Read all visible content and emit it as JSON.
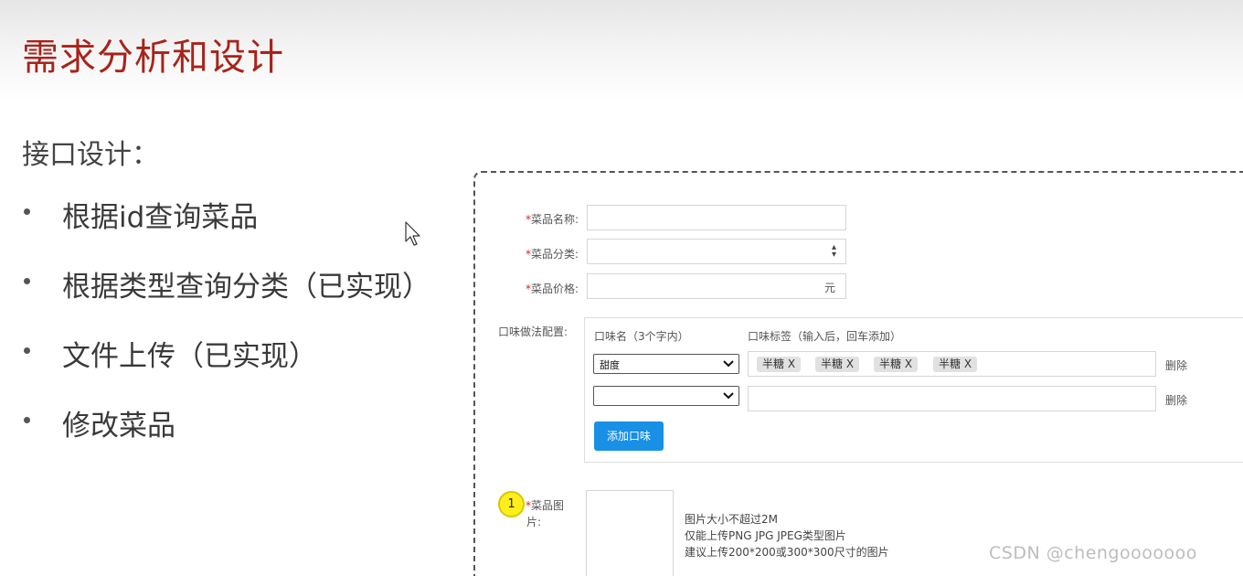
{
  "slide": {
    "title": "需求分析和设计",
    "subtitle": "接口设计：",
    "bullets": [
      "根据id查询菜品",
      "根据类型查询分类（已实现）",
      "文件上传（已实现）",
      "修改菜品"
    ]
  },
  "form": {
    "required_mark": "*",
    "name_label": "菜品名称:",
    "name_value": "",
    "category_label": "菜品分类:",
    "category_value": "",
    "price_label": "菜品价格:",
    "price_value": "",
    "price_unit": "元",
    "flavor_config_label": "口味做法配置:",
    "flavor_name_header": "口味名（3个字内）",
    "flavor_tags_header": "口味标签（输入后，回车添加）",
    "flavor_rows": [
      {
        "name": "甜度",
        "tags": [
          "半糖 X",
          "半糖 X",
          "半糖 X",
          "半糖 X"
        ],
        "delete_label": "删除"
      },
      {
        "name": "",
        "tags": [],
        "delete_label": "删除"
      }
    ],
    "add_flavor_button": "添加口味",
    "image_label_line1": "菜品图",
    "image_label_line2": "片:",
    "step_number": "1",
    "image_hints": [
      "图片大小不超过2M",
      "仅能上传PNG JPG JPEG类型图片",
      "建议上传200*200或300*300尺寸的图片"
    ]
  },
  "watermark": "CSDN @chengooooooo",
  "colors": {
    "title": "#a8231a",
    "required": "#e02020",
    "button": "#1890e6",
    "badge": "#ffef1a"
  },
  "icons": [
    "mouse-cursor-icon",
    "sort-arrows-icon",
    "chevron-down-icon"
  ]
}
